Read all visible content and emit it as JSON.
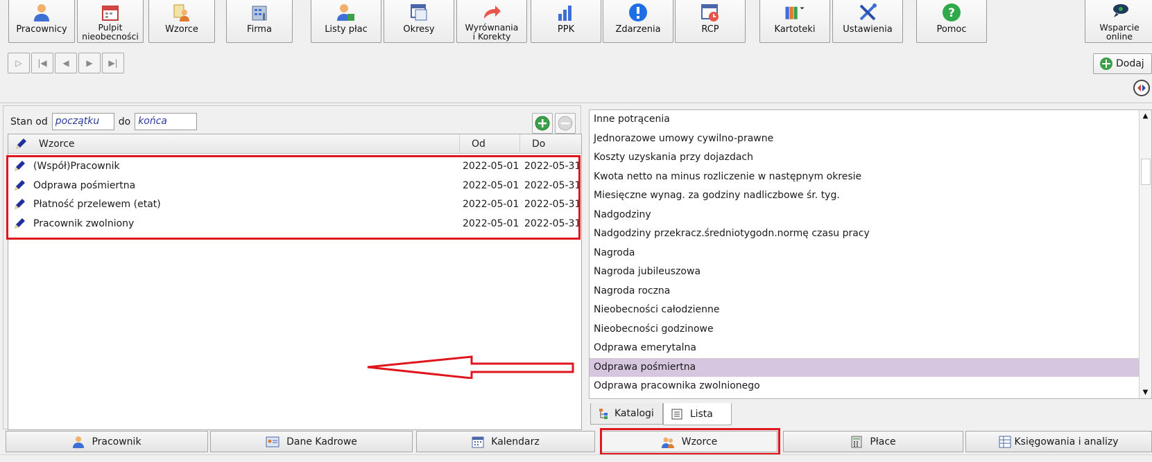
{
  "toolbar": {
    "buttons": [
      {
        "id": "pracownicy",
        "label": "Pracownicy",
        "icon": "person-icon"
      },
      {
        "id": "pulpit",
        "label": "Pulpit\nnieobecności",
        "icon": "calendar-icon"
      },
      {
        "id": "wzorce",
        "label": "Wzorce",
        "icon": "templates-icon"
      },
      {
        "id": "firma",
        "label": "Firma",
        "icon": "building-icon"
      },
      {
        "id": "listy",
        "label": "Listy płac",
        "icon": "payroll-icon"
      },
      {
        "id": "okresy",
        "label": "Okresy",
        "icon": "periods-icon"
      },
      {
        "id": "wyrownania",
        "label": "Wyrównania\ni Korekty",
        "icon": "undo-arrow-icon"
      },
      {
        "id": "ppk",
        "label": "PPK",
        "icon": "bar-chart-icon"
      },
      {
        "id": "zdarzenia",
        "label": "Zdarzenia",
        "icon": "info-icon"
      },
      {
        "id": "rcp",
        "label": "RCP",
        "icon": "clock-calendar-icon"
      },
      {
        "id": "kartoteki",
        "label": "Kartoteki",
        "icon": "binders-icon"
      },
      {
        "id": "ustawienia",
        "label": "Ustawienia",
        "icon": "tools-icon"
      },
      {
        "id": "pomoc",
        "label": "Pomoc",
        "icon": "help-icon"
      },
      {
        "id": "wsparcie",
        "label": "Wsparcie\nonline",
        "icon": "support-icon"
      }
    ],
    "dodaj_label": "Dodaj"
  },
  "filter": {
    "stan_od_label": "Stan od",
    "from_value": "początku",
    "do_label": "do",
    "to_value": "końca"
  },
  "grid": {
    "headers": {
      "name": "Wzorce",
      "od": "Od",
      "do": "Do"
    },
    "rows": [
      {
        "name": "(Współ)Pracownik",
        "od": "2022-05-01",
        "do": "2022-05-31"
      },
      {
        "name": "Odprawa pośmiertna",
        "od": "2022-05-01",
        "do": "2022-05-31"
      },
      {
        "name": "Płatność przelewem (etat)",
        "od": "2022-05-01",
        "do": "2022-05-31"
      },
      {
        "name": "Pracownik zwolniony",
        "od": "2022-05-01",
        "do": "2022-05-31"
      }
    ]
  },
  "right_list": {
    "items": [
      "Inne potrącenia",
      "Jednorazowe umowy cywilno-prawne",
      "Koszty uzyskania przy dojazdach",
      "Kwota netto na minus rozliczenie w następnym okresie",
      "Miesięczne wynag. za godziny nadliczbowe śr. tyg.",
      "Nadgodziny",
      "Nadgodziny przekracz.średniotygodn.normę czasu pracy",
      "Nagroda",
      "Nagroda jubileuszowa",
      "Nagroda roczna",
      "Nieobecności całodzienne",
      "Nieobecności godzinowe",
      "Odprawa emerytalna",
      "Odprawa pośmiertna",
      "Odprawa pracownika zwolnionego"
    ],
    "selected": "Odprawa pośmiertna",
    "tabs": [
      "Katalogi",
      "Lista"
    ]
  },
  "bottom_tabs": [
    "Pracownik",
    "Dane Kadrowe",
    "Kalendarz",
    "Wzorce",
    "Płace",
    "Księgowania i analizy"
  ],
  "colors": {
    "highlight": "#e0161e",
    "selection": "#d6c6df",
    "pen_blue": "#1f2f9c"
  }
}
